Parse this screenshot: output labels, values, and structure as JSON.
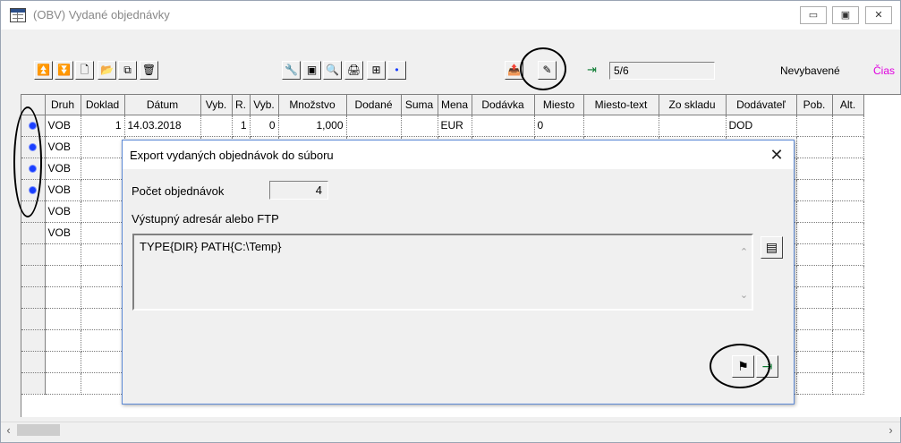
{
  "window": {
    "title": "(OBV) Vydané objednávky",
    "minimize_glyph": "▭",
    "maximize_glyph": "▣",
    "close_glyph": "✕"
  },
  "toolbar": {
    "counter": "5/6",
    "status_unassigned": "Nevybavené",
    "status_partial": "Čias"
  },
  "grid": {
    "columns": [
      "Druh",
      "Doklad",
      "Dátum",
      "Vyb.",
      "R.",
      "Vyb.",
      "Množstvo",
      "Dodané",
      "Suma",
      "Mena",
      "Dodávka",
      "Miesto",
      "Miesto-text",
      "Zo skladu",
      "Dodávateľ",
      "Pob.",
      "Alt."
    ],
    "rows": [
      {
        "selected": true,
        "druh": "VOB",
        "doklad": "1",
        "datum": "14.03.2018",
        "vyb": "",
        "r": "1",
        "vyb2": "0",
        "mnozstvo": "1,000",
        "dodane": "",
        "suma": "",
        "mena": "EUR",
        "dodavka": "",
        "miesto": "0",
        "miesto_text": "",
        "zo_skladu": "",
        "dodavatel": "DOD",
        "pob": "",
        "alt": ""
      },
      {
        "selected": true,
        "druh": "VOB"
      },
      {
        "selected": true,
        "druh": "VOB"
      },
      {
        "selected": true,
        "druh": "VOB"
      },
      {
        "selected": false,
        "druh": "VOB"
      },
      {
        "selected": false,
        "druh": "VOB"
      }
    ]
  },
  "dialog": {
    "title": "Export vydaných objednávok do súboru",
    "close_glyph": "✕",
    "count_label": "Počet objednávok",
    "count_value": "4",
    "dir_label": "Výstupný adresár alebo FTP",
    "dir_value": "TYPE{DIR} PATH{C:\\Temp}"
  },
  "icons": {
    "first_record": "⏫",
    "last_record": "⏬",
    "new": "🗋",
    "open": "📂",
    "copy": "⧉",
    "delete": "🗑",
    "tools": "🔧",
    "screen": "▣",
    "search": "🔍",
    "print": "🖨",
    "fit": "⊞",
    "dot": "•",
    "export": "📤",
    "magic": "✎",
    "exit": "⇥",
    "browse": "▤",
    "flag": "⚑",
    "door": "⇥"
  }
}
